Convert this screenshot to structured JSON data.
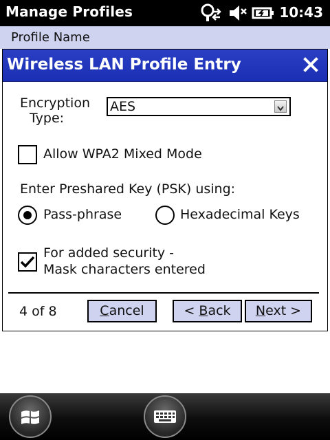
{
  "status_bar": {
    "title": "Manage Profiles",
    "time": "10:43",
    "icons": [
      "connectivity-icon",
      "volume-icon",
      "battery-icon"
    ]
  },
  "list": {
    "header": "Profile Name"
  },
  "dialog": {
    "title": "Wireless LAN Profile Entry",
    "close_icon": "close-icon",
    "encryption_label_line1": "Encryption",
    "encryption_label_line2": "Type:",
    "encryption_value": "AES",
    "wpa2_mixed_label": "Allow WPA2 Mixed Mode",
    "wpa2_mixed_checked": false,
    "psk_prompt": "Enter Preshared Key (PSK) using:",
    "radio_passphrase": "Pass-phrase",
    "radio_hex": "Hexadecimal Keys",
    "psk_mode_selected": "Pass-phrase",
    "mask_label_line1": "For added security -",
    "mask_label_line2": "Mask characters entered",
    "mask_checked": true,
    "page_indicator": "4 of 8",
    "cancel_mnemonic": "C",
    "cancel_rest": "ancel",
    "back_prefix": "< ",
    "back_mnemonic": "B",
    "back_rest": "ack",
    "next_mnemonic": "N",
    "next_rest": "ext >"
  },
  "taskbar": {
    "start_icon": "windows-start-icon",
    "keyboard_icon": "keyboard-icon"
  },
  "colors": {
    "title_bar": "#1a2fb3",
    "button_fill": "#cfd3ef",
    "status_bar": "#000000"
  }
}
